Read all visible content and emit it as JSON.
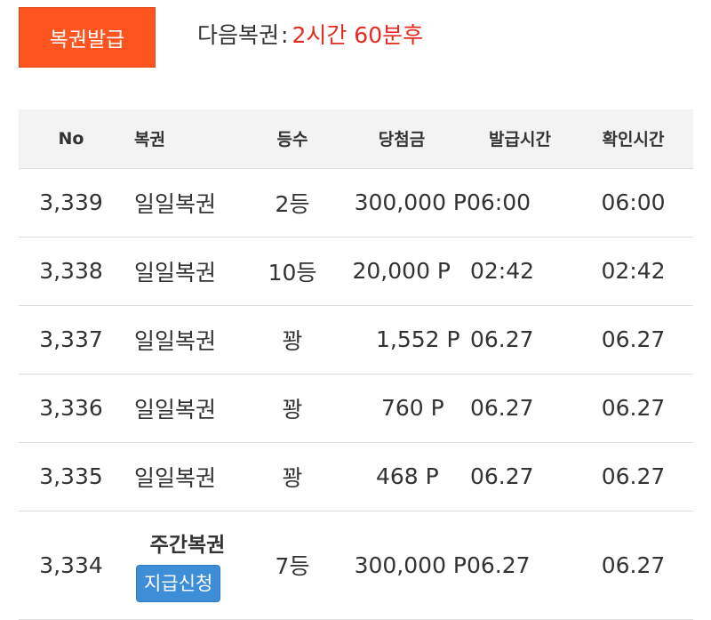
{
  "header": {
    "issue_button_label": "복권발급",
    "next_label": "다음복권",
    "next_separator": ":",
    "next_time": "2시간 60분후"
  },
  "table": {
    "columns": [
      "No",
      "복권",
      "등수",
      "당첨금",
      "발급시간",
      "확인시간"
    ],
    "rows": [
      {
        "no": "3,339",
        "name": "일일복권",
        "rank": "2등",
        "prize": "300,000 P",
        "issued": "06:00",
        "checked": "06:00"
      },
      {
        "no": "3,338",
        "name": "일일복권",
        "rank": "10등",
        "prize": "20,000 P",
        "issued": "02:42",
        "checked": "02:42"
      },
      {
        "no": "3,337",
        "name": "일일복권",
        "rank": "꽝",
        "prize": "1,552 P",
        "issued": "06.27",
        "checked": "06.27"
      },
      {
        "no": "3,336",
        "name": "일일복권",
        "rank": "꽝",
        "prize": "760 P",
        "issued": "06.27",
        "checked": "06.27"
      },
      {
        "no": "3,335",
        "name": "일일복권",
        "rank": "꽝",
        "prize": "468 P",
        "issued": "06.27",
        "checked": "06.27"
      },
      {
        "no": "3,334",
        "name": "주간복권",
        "claim_label": "지급신청",
        "rank": "7등",
        "prize": "300,000 P",
        "issued": "06.27",
        "checked": "06.27"
      }
    ]
  },
  "colors": {
    "issue_button_bg": "#fd5420",
    "next_time_text": "#e52b1f",
    "claim_button_bg": "#3d8ed6",
    "header_row_bg": "#f3f3f3"
  }
}
